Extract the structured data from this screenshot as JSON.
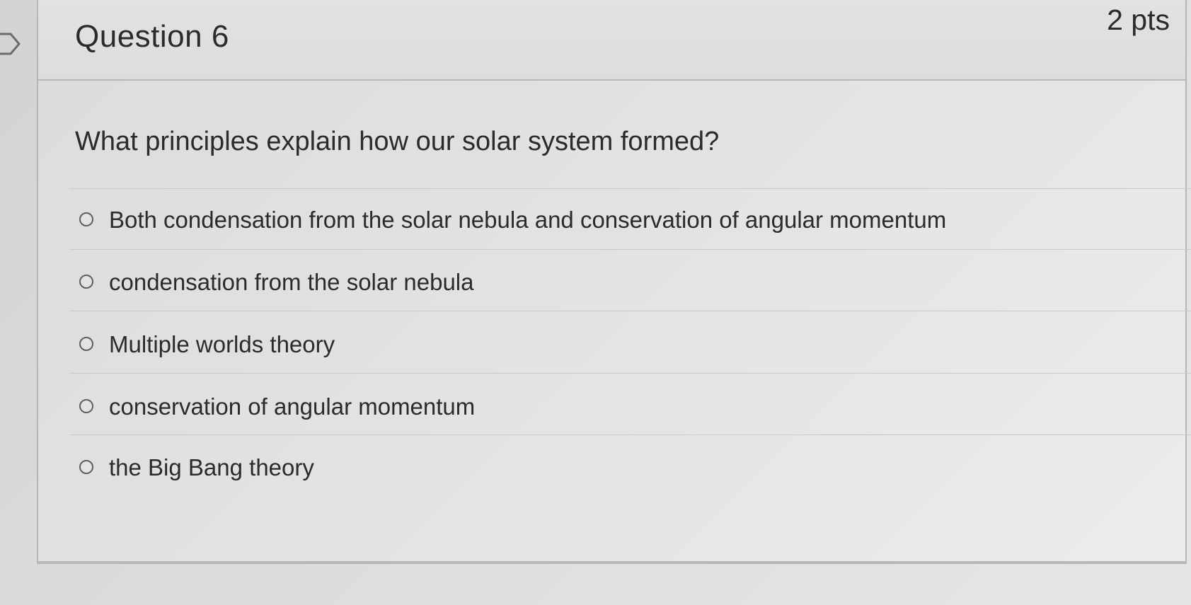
{
  "question": {
    "title": "Question 6",
    "points": "2 pts",
    "text": "What principles explain how our solar system formed?"
  },
  "answers": [
    {
      "label": "Both condensation from the solar nebula and conservation of angular momentum"
    },
    {
      "label": "condensation from the solar nebula"
    },
    {
      "label": "Multiple worlds theory"
    },
    {
      "label": "conservation of angular momentum"
    },
    {
      "label": "the Big Bang theory"
    }
  ],
  "icons": {
    "flag": "bookmark-flag-icon",
    "radio": "radio-button-icon"
  },
  "colors": {
    "text": "#2b2b2b",
    "divider": "#c9c9c9",
    "border": "#b6b6b6",
    "radio": "#5f5f5f"
  }
}
